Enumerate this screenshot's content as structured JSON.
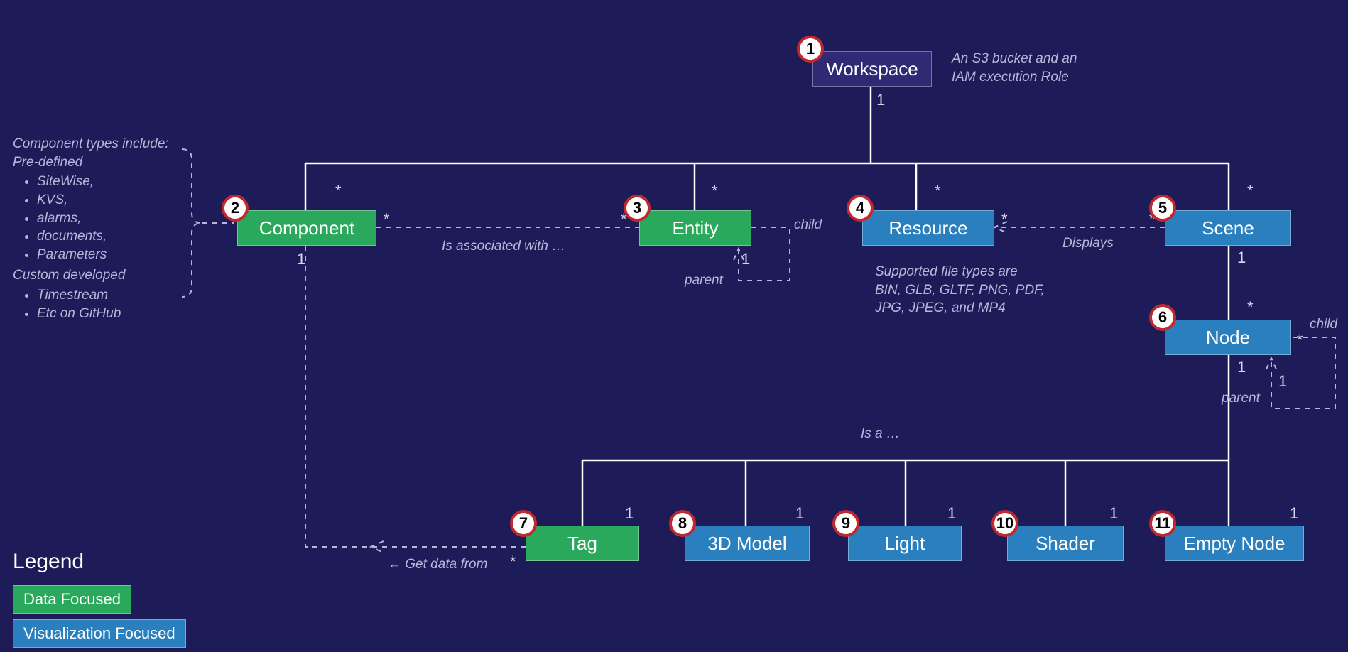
{
  "nodes": {
    "workspace": {
      "num": "1",
      "label": "Workspace",
      "type": "dark"
    },
    "component": {
      "num": "2",
      "label": "Component",
      "type": "green"
    },
    "entity": {
      "num": "3",
      "label": "Entity",
      "type": "green"
    },
    "resource": {
      "num": "4",
      "label": "Resource",
      "type": "blue"
    },
    "scene": {
      "num": "5",
      "label": "Scene",
      "type": "blue"
    },
    "node": {
      "num": "6",
      "label": "Node",
      "type": "blue"
    },
    "tag": {
      "num": "7",
      "label": "Tag",
      "type": "green"
    },
    "model": {
      "num": "8",
      "label": "3D Model",
      "type": "blue"
    },
    "light": {
      "num": "9",
      "label": "Light",
      "type": "blue"
    },
    "shader": {
      "num": "10",
      "label": "Shader",
      "type": "blue"
    },
    "empty": {
      "num": "11",
      "label": "Empty Node",
      "type": "blue"
    }
  },
  "annotations": {
    "workspace_note": "An S3 bucket and an\nIAM execution Role",
    "resource_note": "Supported file types are\nBIN, GLB, GLTF, PNG, PDF,\nJPG, JPEG, and MP4",
    "component_note_head": "Component types include:",
    "component_note_sub1": "Pre-defined",
    "component_note_items1": [
      "SiteWise,",
      "KVS,",
      "alarms,",
      "documents,",
      "Parameters"
    ],
    "component_note_sub2": "Custom developed",
    "component_note_items2": [
      "Timestream",
      "Etc on GitHub"
    ]
  },
  "edge_labels": {
    "assoc": "Is associated with …",
    "displays": "Displays",
    "isa": "Is a …",
    "getdata": "Get data from",
    "child_e": "child",
    "parent_e": "parent",
    "child_n": "child",
    "parent_n": "parent"
  },
  "mult": {
    "ws_bottom": "1",
    "comp_top": "*",
    "ent_top": "*",
    "res_top": "*",
    "scene_top": "*",
    "comp_right": "*",
    "ent_left": "*",
    "comp_bottom": "1",
    "ent_bottom_one": "1",
    "scene_left": "*",
    "res_right": "*",
    "scene_bottom": "1",
    "node_top": "*",
    "node_bottom": "1",
    "node_right": "*",
    "node_loop_one": "1",
    "tag_top": "1",
    "model_top": "1",
    "light_top": "1",
    "shader_top": "1",
    "empty_top": "1",
    "tag_left": "*"
  },
  "legend": {
    "title": "Legend",
    "data_focused": "Data Focused",
    "viz_focused": "Visualization Focused"
  }
}
